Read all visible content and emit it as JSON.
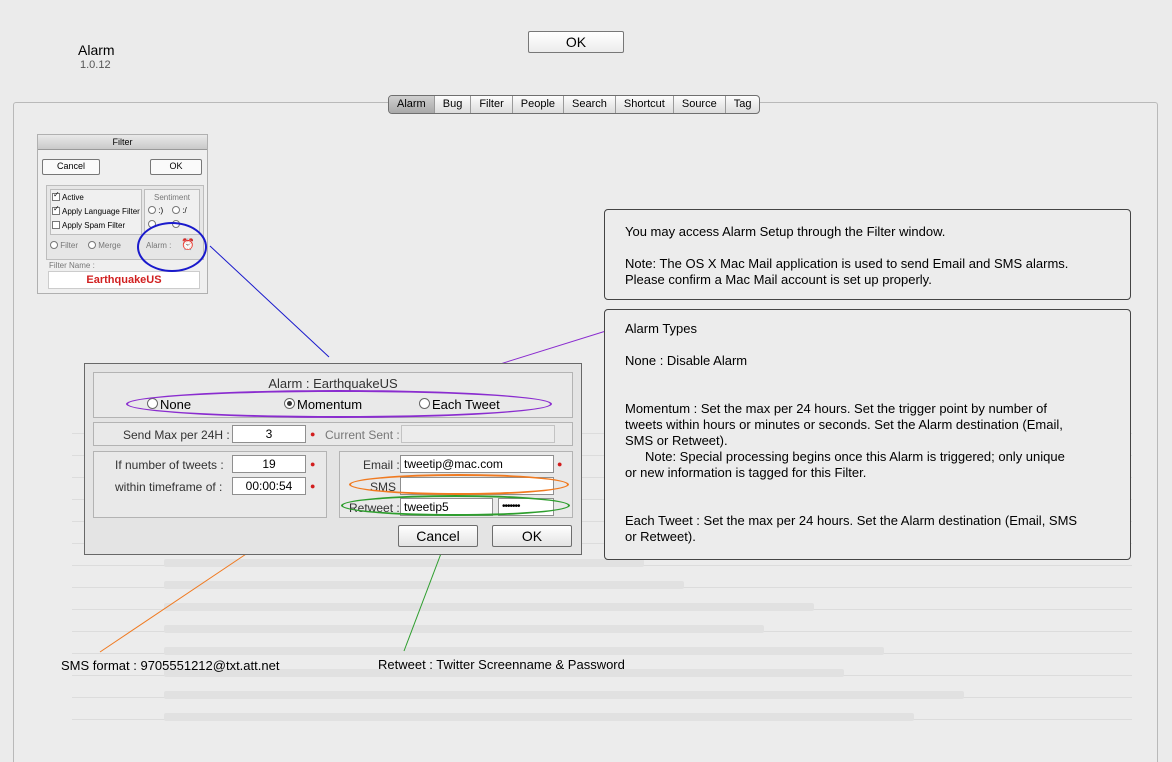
{
  "header": {
    "app_name": "Alarm",
    "version": "1.0.12",
    "ok_label": "OK"
  },
  "tabs": [
    {
      "label": "Alarm",
      "selected": true
    },
    {
      "label": "Bug",
      "selected": false
    },
    {
      "label": "Filter",
      "selected": false
    },
    {
      "label": "People",
      "selected": false
    },
    {
      "label": "Search",
      "selected": false
    },
    {
      "label": "Shortcut",
      "selected": false
    },
    {
      "label": "Source",
      "selected": false
    },
    {
      "label": "Tag",
      "selected": false
    }
  ],
  "filter_window": {
    "title": "Filter",
    "cancel": "Cancel",
    "ok": "OK",
    "active": "Active",
    "apply_language": "Apply Language Filter",
    "apply_spam": "Apply Spam Filter",
    "sentiment": "Sentiment",
    "sent_happy": ":)",
    "sent_meh": ":/",
    "filter_opt": "Filter",
    "merge_opt": "Merge",
    "alarm_label": "Alarm :",
    "filter_name_label": "Filter Name :",
    "filter_name": "EarthquakeUS"
  },
  "info_setup": {
    "line1": "You may access Alarm Setup through the Filter window.",
    "line2": "Note: The OS X Mac Mail application is used to send Email and SMS alarms.",
    "line3": "Please confirm a Mac Mail account is set up properly."
  },
  "info_types": {
    "heading": "Alarm Types",
    "none": "None : Disable Alarm",
    "momentum1": "Momentum : Set the max per 24 hours. Set the trigger point by number of",
    "momentum2": "tweets within hours or minutes or seconds. Set the Alarm destination (Email,",
    "momentum3": "SMS or Retweet).",
    "note1": "Note: Special processing begins once this Alarm is triggered; only unique",
    "note2": "or new information is tagged for this Filter.",
    "each1": "Each Tweet : Set the max per 24 hours. Set the Alarm destination (Email, SMS",
    "each2": "or Retweet)."
  },
  "alarm_dialog": {
    "title": "Alarm : EarthquakeUS",
    "radio_none": "None",
    "radio_momentum": "Momentum",
    "radio_each": "Each Tweet",
    "selected": "Momentum",
    "send_max_label": "Send Max per 24H :",
    "send_max_value": "3",
    "current_sent_label": "Current Sent :",
    "current_sent_value": "",
    "if_tweets_label": "If number of tweets :",
    "if_tweets_value": "19",
    "within_label": "within timeframe of :",
    "within_value": "00:00:54",
    "email_label": "Email :",
    "email_value": "tweetip@mac.com",
    "sms_label": "SMS :",
    "sms_value": "",
    "retweet_label": "Retweet :",
    "retweet_user": "tweetip5",
    "retweet_password": "•••••••",
    "cancel": "Cancel",
    "ok": "OK"
  },
  "callouts": {
    "sms_format": "SMS format : 9705551212@txt.att.net",
    "retweet_format": "Retweet : Twitter Screenname & Password"
  },
  "colors": {
    "blue_line": "#1a1acc",
    "purple": "#8a2ccf",
    "orange": "#f07a20",
    "green": "#2e9e2e",
    "red_text": "#d12020"
  }
}
